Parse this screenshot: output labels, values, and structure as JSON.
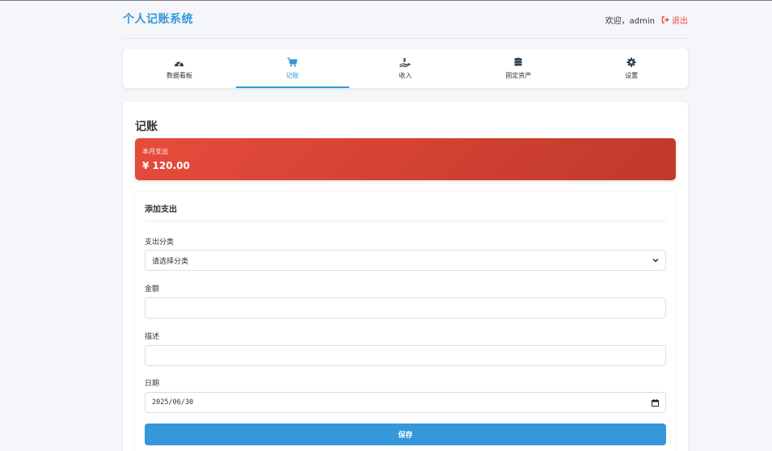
{
  "header": {
    "title": "个人记账系统",
    "welcome": "欢迎，admin",
    "logout_label": "退出"
  },
  "nav": {
    "items": [
      {
        "label": "数据看板",
        "icon": "dashboard-icon"
      },
      {
        "label": "记账",
        "icon": "cart-icon"
      },
      {
        "label": "收入",
        "icon": "hand-coin-icon"
      },
      {
        "label": "固定资产",
        "icon": "coins-icon"
      },
      {
        "label": "设置",
        "icon": "gear-icon"
      }
    ],
    "active": "记账"
  },
  "main": {
    "title": "记账",
    "summary": {
      "label": "本月支出",
      "value": "¥ 120.00"
    },
    "form": {
      "title": "添加支出",
      "category_label": "支出分类",
      "category_value": "请选择分类",
      "amount_label": "金额",
      "amount_value": "",
      "desc_label": "描述",
      "desc_value": "",
      "date_label": "日期",
      "date_value": "2025/06/30",
      "save_label": "保存"
    }
  },
  "colors": {
    "primary": "#3498db",
    "danger": "#e74c3c",
    "danger_dark": "#c0392b"
  }
}
